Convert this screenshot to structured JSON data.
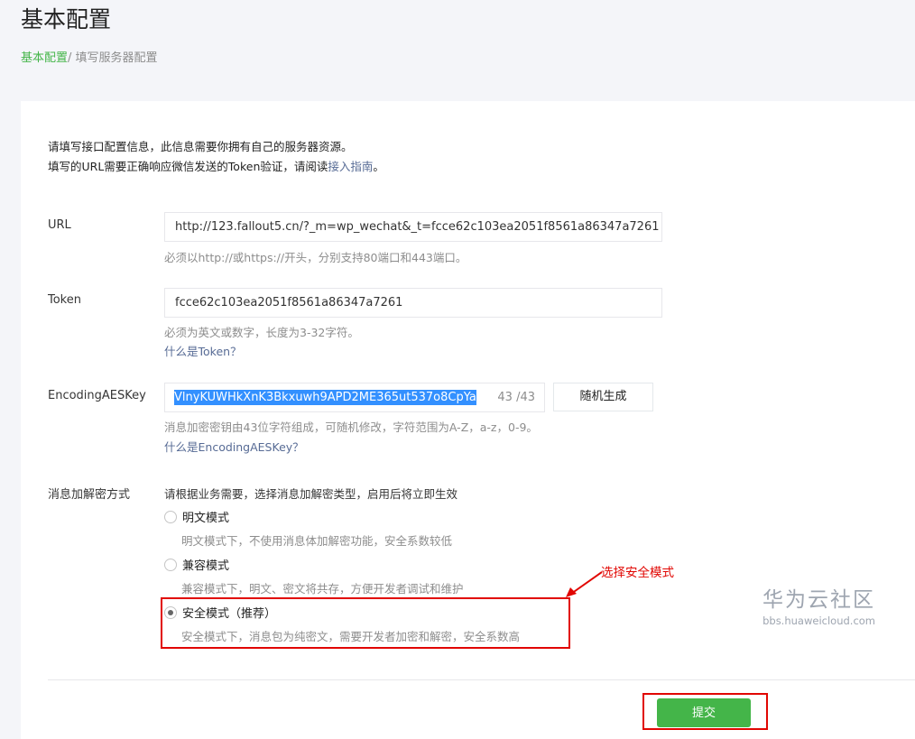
{
  "header": {
    "title": "基本配置",
    "breadcrumb_root": "基本配置",
    "breadcrumb_sep": "/ ",
    "breadcrumb_current": "填写服务器配置"
  },
  "intro": {
    "line1": "请填写接口配置信息，此信息需要你拥有自己的服务器资源。",
    "line2_prefix": "填写的URL需要正确响应微信发送的Token验证，请阅读",
    "line2_link": "接入指南",
    "line2_suffix": "。"
  },
  "url_field": {
    "label": "URL",
    "value": "http://123.fallout5.cn/?_m=wp_wechat&_t=fcce62c103ea2051f8561a86347a7261",
    "hint": "必须以http://或https://开头，分别支持80端口和443端口。"
  },
  "token_field": {
    "label": "Token",
    "value": "fcce62c103ea2051f8561a86347a7261",
    "hint": "必须为英文或数字，长度为3-32字符。",
    "help_link": "什么是Token？"
  },
  "aes_field": {
    "label": "EncodingAESKey",
    "value": "VlnyKUWHkXnK3Bkxuwh9APD2ME365ut537o8CpYa",
    "count": "43 /43",
    "random_button": "随机生成",
    "hint": "消息加密密钥由43位字符组成，可随机修改，字符范围为A-Z，a-z，0-9。",
    "help_link": "什么是EncodingAESKey？"
  },
  "encryption": {
    "label": "消息加解密方式",
    "hint": "请根据业务需要，选择消息加解密类型，启用后将立即生效",
    "options": [
      {
        "label": "明文模式",
        "desc": "明文模式下，不使用消息体加解密功能，安全系数较低",
        "checked": false
      },
      {
        "label": "兼容模式",
        "desc": "兼容模式下，明文、密文将共存，方便开发者调试和维护",
        "checked": false
      },
      {
        "label": "安全模式（推荐）",
        "desc": "安全模式下，消息包为纯密文，需要开发者加密和解密，安全系数高",
        "checked": true
      }
    ]
  },
  "annotation": {
    "text": "选择安全模式",
    "color": "#e10602"
  },
  "footer": {
    "submit_label": "提交",
    "accent": "#44b549"
  },
  "watermark": {
    "main": "华为云社区",
    "sub": "bbs.huaweicloud.com"
  }
}
